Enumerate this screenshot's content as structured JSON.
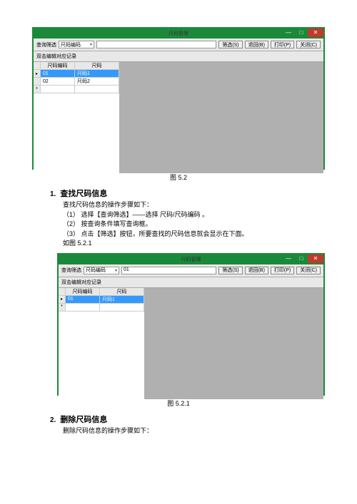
{
  "win1": {
    "title": "尺码管理",
    "filter_label": "查询筛选",
    "combo_value": "尺码编码",
    "search_value": "",
    "btn_filter": "筛选(S)",
    "btn_back": "退回(B)",
    "btn_print": "打印(P)",
    "btn_close": "关闭(C)",
    "subtitle": "双击编辑对应记录",
    "cols": {
      "code": "尺码编码",
      "size": "尺码"
    },
    "rows": [
      {
        "code": "01",
        "size": "尺码1",
        "selected": true
      },
      {
        "code": "02",
        "size": "尺码2"
      }
    ]
  },
  "caption1": "图 5.2",
  "section1": {
    "num": "1.",
    "title": "查找尺码信息",
    "intro": "查找尺码信息的操作步骤如下：",
    "step1": "（1）  选择【查询筛选】——选择 尺码/尺码编码 。",
    "step2": "（2）  按查询条件填写查询框。",
    "step3": "（3）  点击【筛选】按钮，所要查找的尺码信息就会显示在下面。",
    "ref": "如图 5.2.1"
  },
  "win2": {
    "title": "尺码管理",
    "filter_label": "查询筛选",
    "combo_value": "尺码编码",
    "search_value": "01",
    "btn_filter": "筛选(S)",
    "btn_back": "退回(B)",
    "btn_print": "打印(P)",
    "btn_close": "关闭(C)",
    "subtitle": "双击编辑对应记录",
    "cols": {
      "code": "尺码编码",
      "size": "尺码"
    },
    "rows": [
      {
        "code": "01",
        "size": "尺码1",
        "selected": true
      }
    ]
  },
  "caption2": "图 5.2.1",
  "section2": {
    "num": "2.",
    "title": "删除尺码信息",
    "intro": "删除尺码信息的操作步骤如下："
  }
}
